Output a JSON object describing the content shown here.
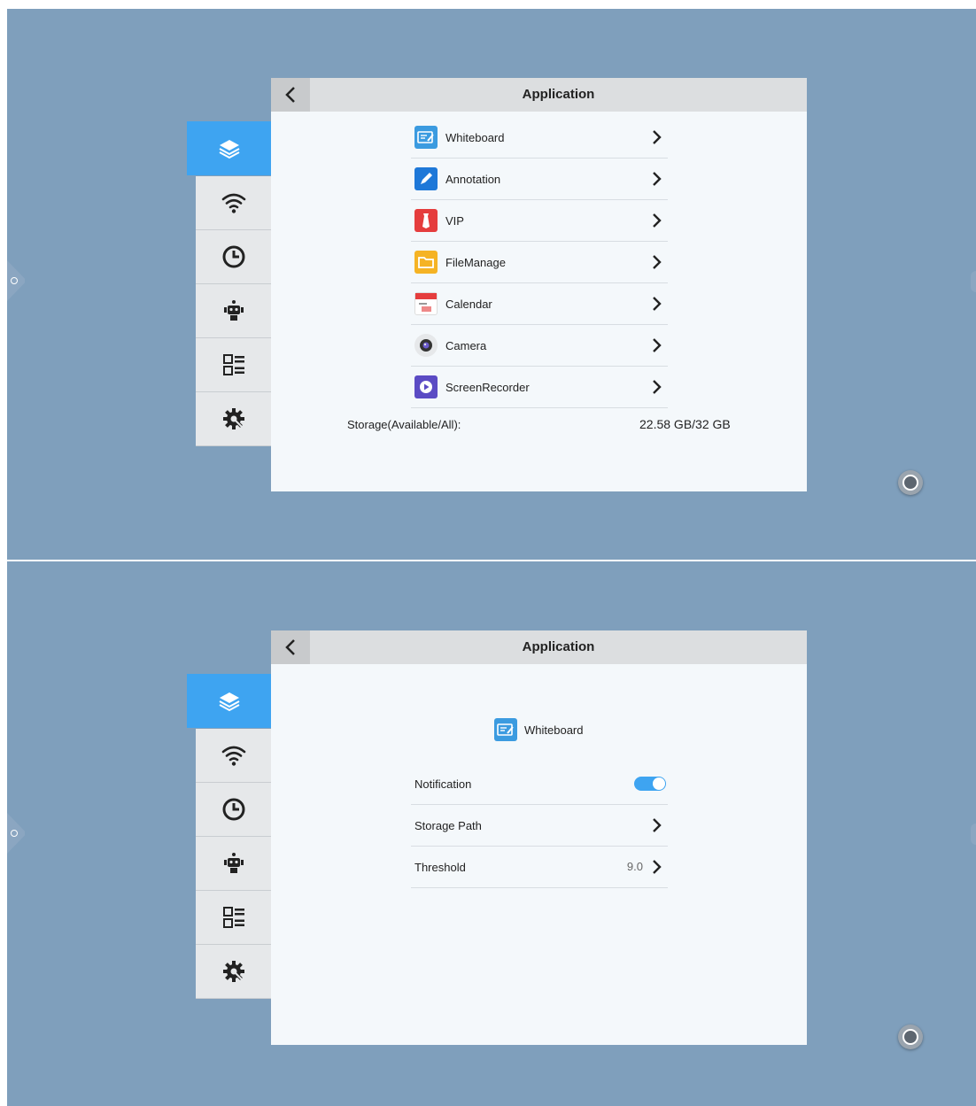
{
  "top_screen": {
    "header": {
      "title": "Application"
    },
    "apps": [
      {
        "name": "Whiteboard",
        "icon": "whiteboard-icon"
      },
      {
        "name": "Annotation",
        "icon": "annotation-icon"
      },
      {
        "name": "VIP",
        "icon": "vip-icon"
      },
      {
        "name": "FileManage",
        "icon": "folder-icon"
      },
      {
        "name": "Calendar",
        "icon": "calendar-icon"
      },
      {
        "name": "Camera",
        "icon": "camera-icon"
      },
      {
        "name": "ScreenRecorder",
        "icon": "screen-recorder-icon"
      }
    ],
    "storage": {
      "label": "Storage(Available/All):",
      "value": "22.58 GB/32 GB"
    }
  },
  "bottom_screen": {
    "header": {
      "title": "Application"
    },
    "app": {
      "name": "Whiteboard",
      "icon": "whiteboard-icon"
    },
    "settings": [
      {
        "label": "Notification",
        "type": "toggle",
        "on": true
      },
      {
        "label": "Storage Path",
        "type": "link"
      },
      {
        "label": "Threshold",
        "type": "value",
        "value": "9.0"
      }
    ]
  },
  "sidebar": [
    {
      "icon": "layers-icon",
      "active": true
    },
    {
      "icon": "wifi-icon",
      "active": false
    },
    {
      "icon": "clock-icon",
      "active": false
    },
    {
      "icon": "robot-icon",
      "active": false
    },
    {
      "icon": "list-grid-icon",
      "active": false
    },
    {
      "icon": "gear-icon",
      "active": false
    }
  ],
  "colors": {
    "accent": "#3ea4f1",
    "background": "#7f9fbc",
    "panel": "#f4f8fb"
  }
}
